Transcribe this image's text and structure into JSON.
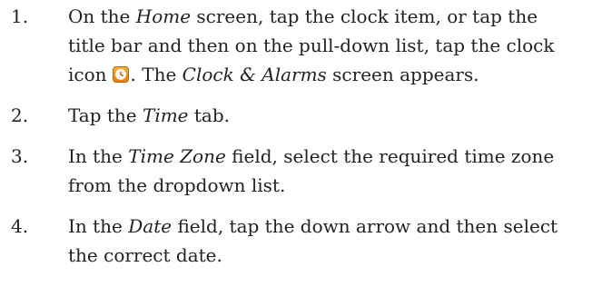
{
  "steps": [
    {
      "number": "1.",
      "parts": {
        "a": "On the ",
        "b": "Home",
        "c": " screen, tap the clock item, or tap the title bar and then on the pull-down list, tap the clock icon",
        "d": ". The ",
        "e": "Clock & Alarms",
        "f": " screen appears."
      }
    },
    {
      "number": "2.",
      "parts": {
        "a": "Tap the ",
        "b": "Time",
        "c": " tab."
      }
    },
    {
      "number": "3.",
      "parts": {
        "a": "In the ",
        "b": "Time Zone",
        "c": " field, select the required time zone from the dropdown list."
      }
    },
    {
      "number": "4.",
      "parts": {
        "a": "In the ",
        "b": "Date",
        "c": " field, tap the down arrow and then select the correct date."
      }
    }
  ],
  "icons": {
    "clock": "clock-icon"
  },
  "colors": {
    "text": "#222222",
    "clock_icon_bg": "#f39a22",
    "clock_icon_border": "#b6650d"
  }
}
